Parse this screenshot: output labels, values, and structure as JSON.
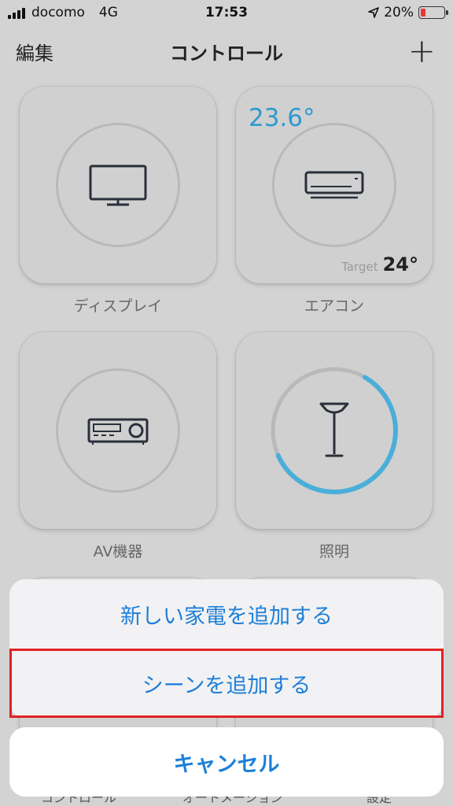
{
  "status_bar": {
    "carrier": "docomo",
    "network": "4G",
    "time": "17:53",
    "battery": "20%",
    "battery_level": 0.2
  },
  "nav": {
    "edit": "編集",
    "title": "コントロール",
    "add": "+"
  },
  "tiles": [
    {
      "label": "ディスプレイ",
      "icon": "tv-icon"
    },
    {
      "label": "エアコン",
      "icon": "air-conditioner-icon",
      "current_temp": "23.6°",
      "target_label": "Target",
      "target_temp": "24°"
    },
    {
      "label": "AV機器",
      "icon": "av-receiver-icon"
    },
    {
      "label": "照明",
      "icon": "floor-lamp-icon",
      "level": 0.6
    }
  ],
  "action_sheet": {
    "add_appliance": "新しい家電を追加する",
    "add_scene": "シーンを追加する",
    "cancel": "キャンセル"
  },
  "tabbar": {
    "items": [
      "コントロール",
      "オートメーション",
      "設定"
    ]
  },
  "colors": {
    "accent": "#1e7fd8",
    "temp": "#2b9bd0",
    "highlight": "#e02222",
    "lamp_ring": "#4aaed9"
  }
}
